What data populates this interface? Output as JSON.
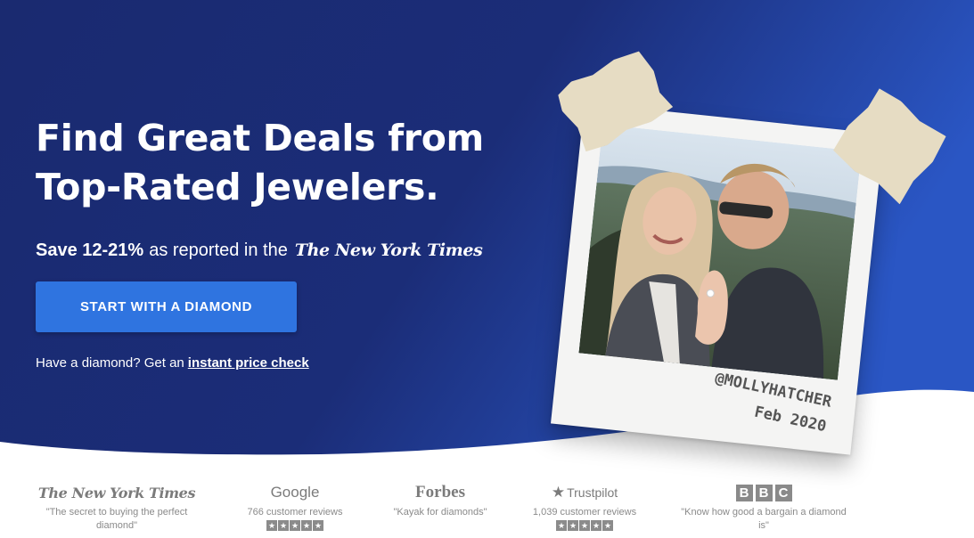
{
  "hero": {
    "headline_line1": "Find Great Deals from",
    "headline_line2": "Top-Rated Jewelers.",
    "subline_bold": "Save 12-21%",
    "subline_text": "as reported in the",
    "subline_source": "The New York Times",
    "cta_label": "START WITH A DIAMOND",
    "price_check_text": "Have a diamond? Get an",
    "price_check_link": "instant price check"
  },
  "polaroid": {
    "handle": "@MOLLYHATCHER",
    "date": "Feb 2020"
  },
  "press": [
    {
      "logo": "The New York Times",
      "text": "\"The secret to buying the perfect diamond\"",
      "stars": null
    },
    {
      "logo": "Google",
      "text": "766 customer reviews",
      "stars": 5
    },
    {
      "logo": "Forbes",
      "text": "\"Kayak for diamonds\"",
      "stars": null
    },
    {
      "logo": "Trustpilot",
      "text": "1,039 customer reviews",
      "stars": 5
    },
    {
      "logo": "BBC",
      "text": "\"Know how good a bargain a diamond is\"",
      "stars": null
    }
  ],
  "colors": {
    "hero_bg": "#1a2a70",
    "hero_bg_light": "#2a56c4",
    "cta_bg": "#2f74e0",
    "press_text": "#8a8a8a"
  },
  "icons": {
    "trustpilot": "star-icon",
    "rating": "star-icon"
  }
}
